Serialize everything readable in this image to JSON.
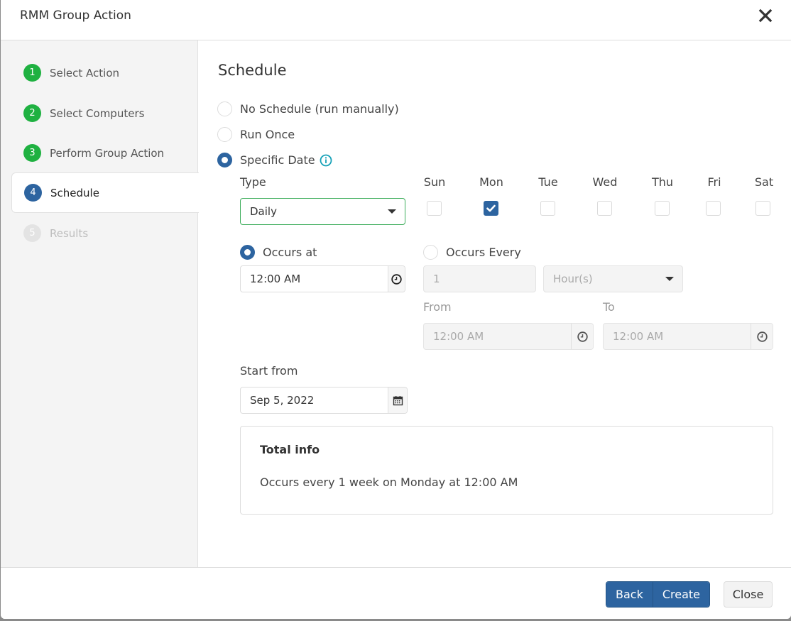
{
  "window": {
    "title": "RMM Group Action",
    "close_icon": "close-x-icon"
  },
  "colors": {
    "primary": "#2d64a0",
    "step_done": "#1fb141",
    "info": "#17a2b8",
    "focus_border": "#3dad5b"
  },
  "steps": [
    {
      "number": "1",
      "label": "Select Action",
      "state": "done"
    },
    {
      "number": "2",
      "label": "Select Computers",
      "state": "done"
    },
    {
      "number": "3",
      "label": "Perform Group Action",
      "state": "done"
    },
    {
      "number": "4",
      "label": "Schedule",
      "state": "current"
    },
    {
      "number": "5",
      "label": "Results",
      "state": "pending"
    }
  ],
  "schedule": {
    "title": "Schedule",
    "options": [
      {
        "label": "No Schedule (run manually)",
        "checked": false
      },
      {
        "label": "Run Once",
        "checked": false
      },
      {
        "label": "Specific Date",
        "checked": true,
        "icon": "info-icon"
      }
    ],
    "type": {
      "label": "Type",
      "value": "Daily"
    },
    "days": [
      {
        "label": "Sun",
        "checked": false
      },
      {
        "label": "Mon",
        "checked": true
      },
      {
        "label": "Tue",
        "checked": false
      },
      {
        "label": "Wed",
        "checked": false
      },
      {
        "label": "Thu",
        "checked": false
      },
      {
        "label": "Fri",
        "checked": false
      },
      {
        "label": "Sat",
        "checked": false
      }
    ],
    "occurs_at": {
      "label": "Occurs at",
      "checked": true,
      "value": "12:00 AM"
    },
    "occurs_every": {
      "label": "Occurs Every",
      "checked": false,
      "value": "1",
      "unit": "Hour(s)",
      "plus": "+",
      "minus": "−"
    },
    "from": {
      "label": "From",
      "value": "12:00 AM"
    },
    "to": {
      "label": "To",
      "value": "12:00 AM"
    },
    "start_from": {
      "label": "Start from",
      "value": "Sep 5, 2022"
    },
    "total_info": {
      "title": "Total info",
      "text": "Occurs every 1 week on Monday at 12:00 AM"
    }
  },
  "footer": {
    "back_label": "Back",
    "create_label": "Create",
    "close_label": "Close"
  }
}
